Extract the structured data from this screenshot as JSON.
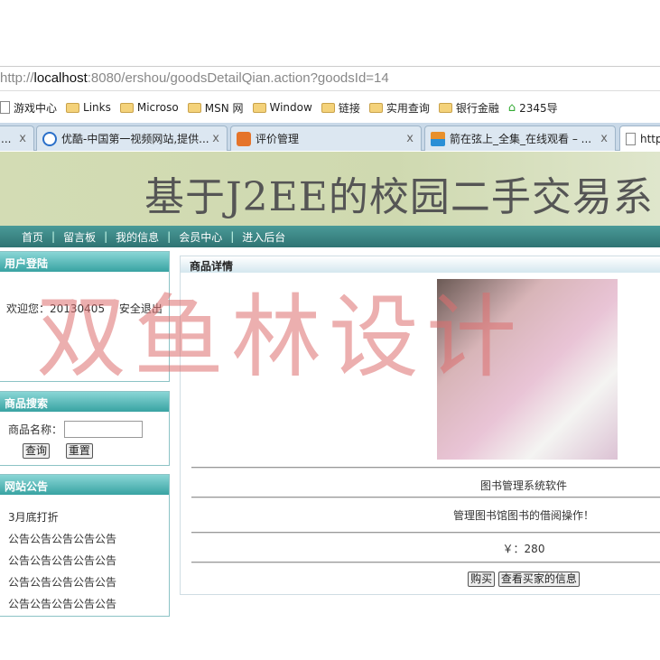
{
  "browser": {
    "address": {
      "prefix": "http://",
      "host": "localhost",
      "rest": ":8080/ershou/goodsDetailQian.action?goodsId=14"
    },
    "bookmarks": [
      "游戏中心",
      "Links",
      "Microso",
      "MSN 网",
      "Window",
      "链接",
      "实用查询",
      "银行金融",
      "2345导"
    ],
    "tabs": [
      {
        "label": "..."
      },
      {
        "label": "优酷-中国第一视频网站,提供..."
      },
      {
        "label": "评价管理"
      },
      {
        "label": "箭在弦上_全集_在线观看 – ..."
      },
      {
        "label": "http"
      }
    ],
    "close_glyph": "x"
  },
  "banner": {
    "title": "基于J2EE的校园二手交易系"
  },
  "nav": [
    "首页",
    "留言板",
    "我的信息",
    "会员中心",
    "进入后台"
  ],
  "nav_sep": "|",
  "login": {
    "title": "用户登陆",
    "welcome": "欢迎您：20130405",
    "logout": "安全退出"
  },
  "search": {
    "title": "商品搜索",
    "label": "商品名称：",
    "value": "",
    "query": "查询",
    "reset": "重置"
  },
  "notice": {
    "title": "网站公告",
    "items": [
      "3月底打折",
      "公告公告公告公告公告",
      "公告公告公告公告公告",
      "公告公告公告公告公告",
      "公告公告公告公告公告"
    ]
  },
  "detail": {
    "title": "商品详情",
    "name": "图书管理系统软件",
    "desc": "管理图书馆图书的借阅操作！",
    "price": "￥：280",
    "buy": "购买",
    "view_buyer": "查看买家的信息"
  },
  "watermark": "双鱼林设计"
}
